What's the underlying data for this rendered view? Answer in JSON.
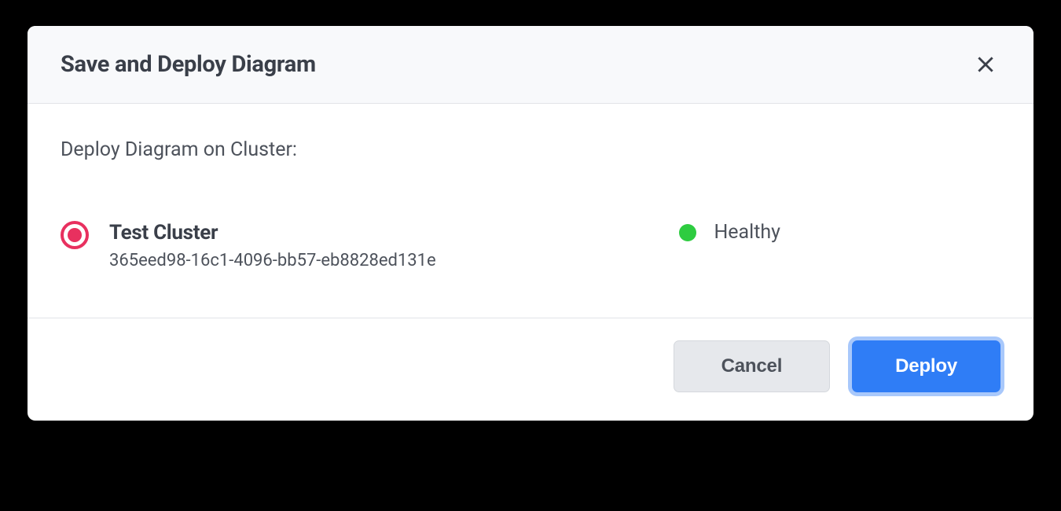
{
  "modal": {
    "title": "Save and Deploy Diagram",
    "prompt": "Deploy Diagram on Cluster:"
  },
  "cluster": {
    "name": "Test Cluster",
    "id": "365eed98-16c1-4096-bb57-eb8828ed131e",
    "status_label": "Healthy",
    "status_color": "#2ecc40",
    "selected": true
  },
  "footer": {
    "cancel_label": "Cancel",
    "deploy_label": "Deploy"
  },
  "colors": {
    "accent_radio": "#e8305f",
    "primary_button": "#2f7df6"
  }
}
